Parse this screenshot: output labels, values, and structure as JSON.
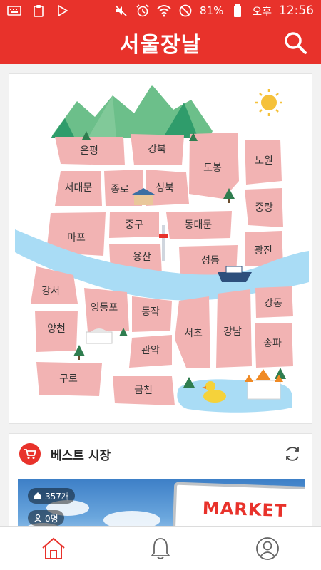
{
  "status_bar": {
    "icons_left": [
      "keyboard-icon",
      "clipboard-icon",
      "play-store-icon"
    ],
    "icons_right": [
      "mute-icon",
      "alarm-icon",
      "wifi-icon",
      "do-not-disturb-icon"
    ],
    "battery": "81%",
    "ampm": "오후",
    "time": "12:56"
  },
  "app_bar": {
    "title": "서울장날",
    "search_icon": "search-icon"
  },
  "map": {
    "districts": {
      "eunpyeong": "은평",
      "gangbuk": "강북",
      "dobong": "도봉",
      "nowon": "노원",
      "seodaemun": "서대문",
      "jongno": "종로",
      "seongbuk": "성북",
      "jungnang": "중랑",
      "mapo": "마포",
      "junggu": "중구",
      "dongdaemun": "동대문",
      "gwangjin": "광진",
      "yongsan": "용산",
      "seongdong": "성동",
      "gangseo": "강서",
      "yeongdeungpo": "영등포",
      "dongjak": "동작",
      "gangdong": "강동",
      "yangcheon": "양천",
      "seocho": "서초",
      "gangnam": "강남",
      "songpa": "송파",
      "gwanak": "관악",
      "guro": "구로",
      "geumcheon": "금천"
    },
    "colors": {
      "district": "#f2b3b3",
      "river": "#a9dcf5",
      "mountain": "#6cbf8a",
      "sun": "#f5c13b"
    }
  },
  "best_markets": {
    "title": "베스트 시장",
    "icon": "cart-icon",
    "refresh_icon": "refresh-icon",
    "banner": {
      "sign_text": "MARKET",
      "count_label": "357개",
      "visitors_label": "0명"
    }
  },
  "bottom_nav": {
    "items": [
      "home-icon",
      "bell-icon",
      "user-icon"
    ],
    "active_color": "#e8322b"
  }
}
